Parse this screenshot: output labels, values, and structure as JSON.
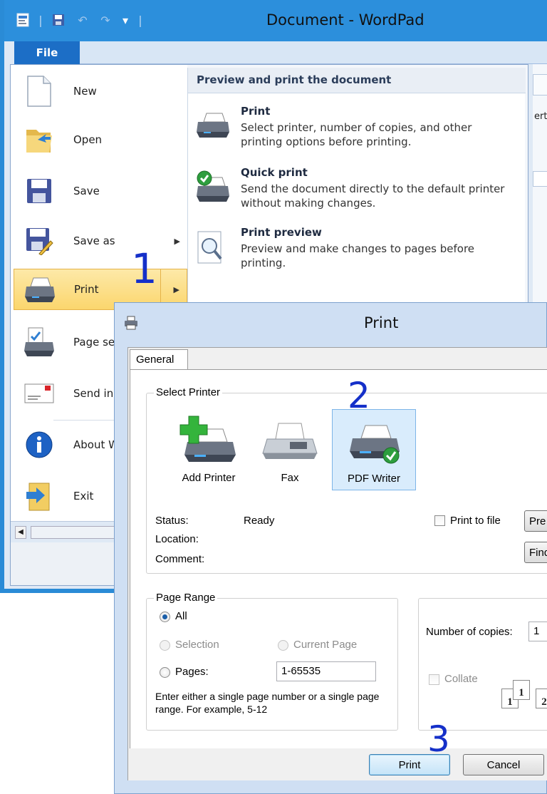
{
  "wordpad": {
    "title": "Document - WordPad",
    "file_tab": "File",
    "ribbon_partial_text": "ert"
  },
  "file_menu": {
    "items": [
      {
        "label": "New",
        "icon": "new-document-icon"
      },
      {
        "label": "Open",
        "icon": "open-folder-icon"
      },
      {
        "label": "Save",
        "icon": "save-disk-icon"
      },
      {
        "label": "Save as",
        "icon": "save-as-icon",
        "submenu": true
      },
      {
        "label": "Print",
        "icon": "printer-icon",
        "submenu": true,
        "active": true
      },
      {
        "label": "Page set",
        "icon": "page-setup-icon"
      },
      {
        "label": "Send in",
        "icon": "send-email-icon"
      },
      {
        "label": "About W",
        "icon": "info-icon"
      },
      {
        "label": "Exit",
        "icon": "exit-icon"
      }
    ]
  },
  "print_submenu": {
    "header": "Preview and print the document",
    "items": [
      {
        "title": "Print",
        "desc": "Select printer, number of copies, and other printing options before printing.",
        "icon": "printer-icon"
      },
      {
        "title": "Quick print",
        "desc": "Send the document directly to the default printer without making changes.",
        "icon": "quick-print-icon"
      },
      {
        "title": "Print preview",
        "desc": "Preview and make changes to pages before printing.",
        "icon": "print-preview-icon"
      }
    ]
  },
  "print_dialog": {
    "title": "Print",
    "tab": "General",
    "select_printer": {
      "group_title": "Select Printer",
      "printers": [
        {
          "label": "Add Printer",
          "icon": "add-printer-icon"
        },
        {
          "label": "Fax",
          "icon": "fax-icon"
        },
        {
          "label": "PDF Writer",
          "icon": "pdf-writer-icon",
          "selected": true
        }
      ],
      "status_label": "Status:",
      "status_value": "Ready",
      "location_label": "Location:",
      "comment_label": "Comment:",
      "print_to_file": "Print to file",
      "preferences_button": "Pre",
      "find_button": "Find"
    },
    "page_range": {
      "group_title": "Page Range",
      "all": "All",
      "selection": "Selection",
      "current_page": "Current Page",
      "pages": "Pages:",
      "pages_value": "1-65535",
      "hint": "Enter either a single page number or a single page range.  For example, 5-12"
    },
    "copies": {
      "label": "Number of copies:",
      "value": "1",
      "collate": "Collate",
      "collate_pages": [
        "1",
        "1",
        "2"
      ]
    },
    "buttons": {
      "print": "Print",
      "cancel": "Cancel"
    }
  },
  "annotations": {
    "step1": "1",
    "step2": "2",
    "step3": "3"
  },
  "colors": {
    "title_bar": "#2c8fdc",
    "file_tab": "#1c6ec6",
    "active_menu": "#fbd66d",
    "step_annotation": "#1530c9"
  }
}
